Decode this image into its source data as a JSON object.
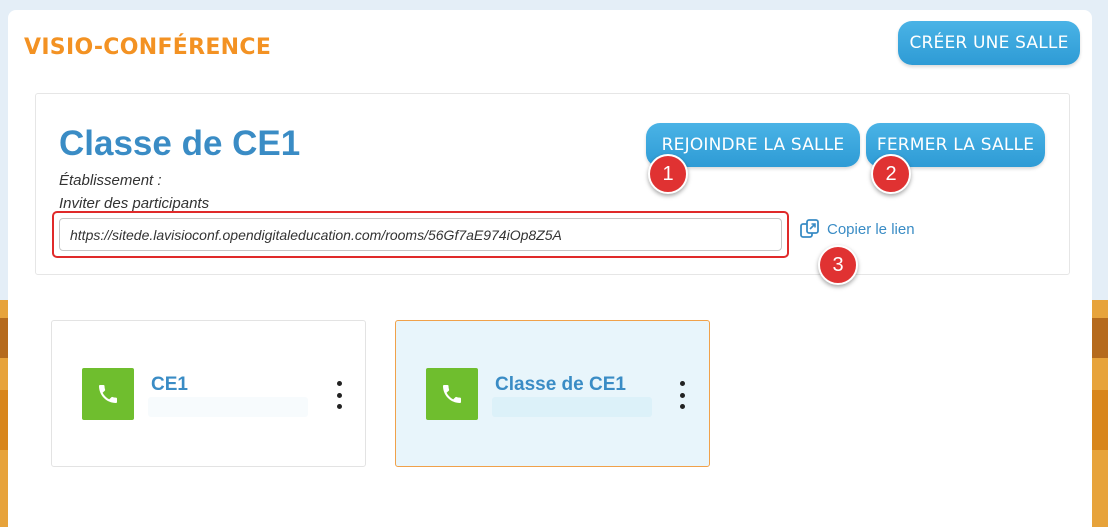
{
  "header": {
    "title": "VISIO-CONFÉRENCE",
    "create_button": "CRÉER UNE SALLE"
  },
  "room": {
    "name": "Classe de CE1",
    "etablissement_label": "Établissement :",
    "invite_label": "Inviter des participants",
    "link_value": "https://sitede.lavisioconf.opendigitaleducation.com/rooms/56Gf7aE974iOp8Z5A",
    "copy_link_label": "Copier le lien",
    "join_button": "REJOINDRE LA SALLE",
    "close_button": "FERMER LA SALLE"
  },
  "annotations": {
    "badge_1": "1",
    "badge_2": "2",
    "badge_3": "3"
  },
  "rooms_list": [
    {
      "name": "CE1",
      "selected": false,
      "icon": "phone-icon"
    },
    {
      "name": "Classe de CE1",
      "selected": true,
      "icon": "phone-icon"
    }
  ],
  "colors": {
    "title_orange": "#f39223",
    "button_blue": "#2e9bd5",
    "room_blue": "#3a8cc5",
    "phone_green": "#6fbe2e",
    "badge_red": "#e03232"
  }
}
